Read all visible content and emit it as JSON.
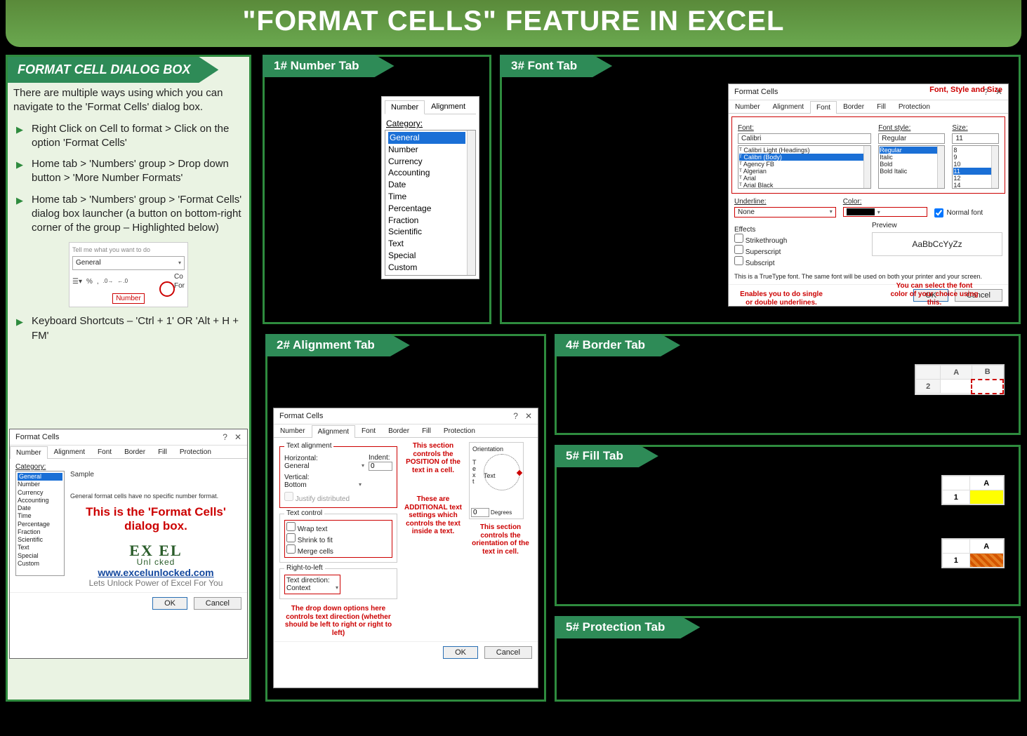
{
  "title": "\"FORMAT CELLS\" FEATURE IN EXCEL",
  "sidebar": {
    "head": "FORMAT CELL DIALOG BOX",
    "intro": "There are multiple ways using which you can navigate to the 'Format Cells' dialog box.",
    "b1": "Right Click on Cell to format > Click on the option 'Format Cells'",
    "b2": "Home tab > 'Numbers' group > Drop down button > 'More Number Formats'",
    "b3": "Home tab > 'Numbers' group > 'Format Cells' dialog box launcher (a button on bottom-right corner of the group – Highlighted below)",
    "b4": "Keyboard Shortcuts – 'Ctrl + 1' OR 'Alt + H + FM'",
    "ribbon": {
      "tell": "Tell me what you want to do",
      "combo": "General",
      "pct": "%",
      "comma": ",",
      "inc": ".0→",
      "dec": "←.0",
      "co": "Co",
      "for": "For",
      "label": "Number"
    }
  },
  "dlg_common": {
    "title": "Format Cells",
    "tabs": {
      "num": "Number",
      "align": "Alignment",
      "font": "Font",
      "border": "Border",
      "fill": "Fill",
      "prot": "Protection"
    },
    "ok": "OK",
    "cancel": "Cancel"
  },
  "sb_dlg": {
    "cat_label": "Category:",
    "cats": [
      "General",
      "Number",
      "Currency",
      "Accounting",
      "Date",
      "Time",
      "Percentage",
      "Fraction",
      "Scientific",
      "Text",
      "Special",
      "Custom"
    ],
    "sample_label": "Sample",
    "desc": "General format cells have no specific number format.",
    "red": "This is the 'Format Cells' dialog box.",
    "logo1": "EX   EL",
    "logo2": "Unl   cked",
    "link": "www.excelunlocked.com",
    "tag": "Lets Unlock Power of Excel For You"
  },
  "tabs": {
    "number": {
      "head": "1# Number Tab",
      "tabs": {
        "num": "Number",
        "align": "Alignment"
      },
      "cat_label": "Category:",
      "cats": [
        "General",
        "Number",
        "Currency",
        "Accounting",
        "Date",
        "Time",
        "Percentage",
        "Fraction",
        "Scientific",
        "Text",
        "Special",
        "Custom"
      ]
    },
    "align": {
      "head": "2# Alignment Tab",
      "ta": "Text alignment",
      "horiz_l": "Horizontal:",
      "horiz_v": "General",
      "indent_l": "Indent:",
      "indent_v": "0",
      "vert_l": "Vertical:",
      "vert_v": "Bottom",
      "justify": "Justify distributed",
      "tc": "Text control",
      "wrap": "Wrap text",
      "shrink": "Shrink to fit",
      "merge": "Merge cells",
      "rtl": "Right-to-left",
      "tdir_l": "Text direction:",
      "tdir_v": "Context",
      "orient": "Orientation",
      "text": "Text",
      "deg_l": "Degrees",
      "deg_v": "0",
      "c1": "This section controls the POSITION of the text in a cell.",
      "c2": "These are ADDITIONAL text settings which controls the text inside a text.",
      "c3": "This section controls the orientation of the text in cell.",
      "c4": "The drop down options here controls text direction (whether should be left to right or right to left)"
    },
    "font": {
      "head": "3# Font Tab",
      "font_l": "Font:",
      "font_v": "Calibri",
      "fonts": [
        "Calibri Light (Headings)",
        "Calibri (Body)",
        "Agency FB",
        "Algerian",
        "Arial",
        "Arial Black"
      ],
      "style_l": "Font style:",
      "style_v": "Regular",
      "styles": [
        "Regular",
        "Italic",
        "Bold",
        "Bold Italic"
      ],
      "size_l": "Size:",
      "size_v": "11",
      "sizes": [
        "8",
        "9",
        "10",
        "11",
        "12",
        "14"
      ],
      "under_l": "Underline:",
      "under_v": "None",
      "color_l": "Color:",
      "normal": "Normal font",
      "eff": "Effects",
      "strike": "Strikethrough",
      "sup": "Superscript",
      "sub": "Subscript",
      "prev_l": "Preview",
      "prev": "AaBbCcYyZz",
      "tt": "This is a TrueType font. The same font will be used on both your printer and your screen.",
      "red_head": "Font, Style and Size",
      "c1": "Enables you to do single or double underlines.",
      "c2": "You can select the font color of your choice using this."
    },
    "border": {
      "head": "4# Border Tab",
      "colA": "A",
      "colB": "B",
      "row": "2"
    },
    "fill": {
      "head": "5# Fill Tab",
      "colA": "A",
      "row": "1"
    },
    "prot": {
      "head": "5# Protection Tab"
    }
  }
}
